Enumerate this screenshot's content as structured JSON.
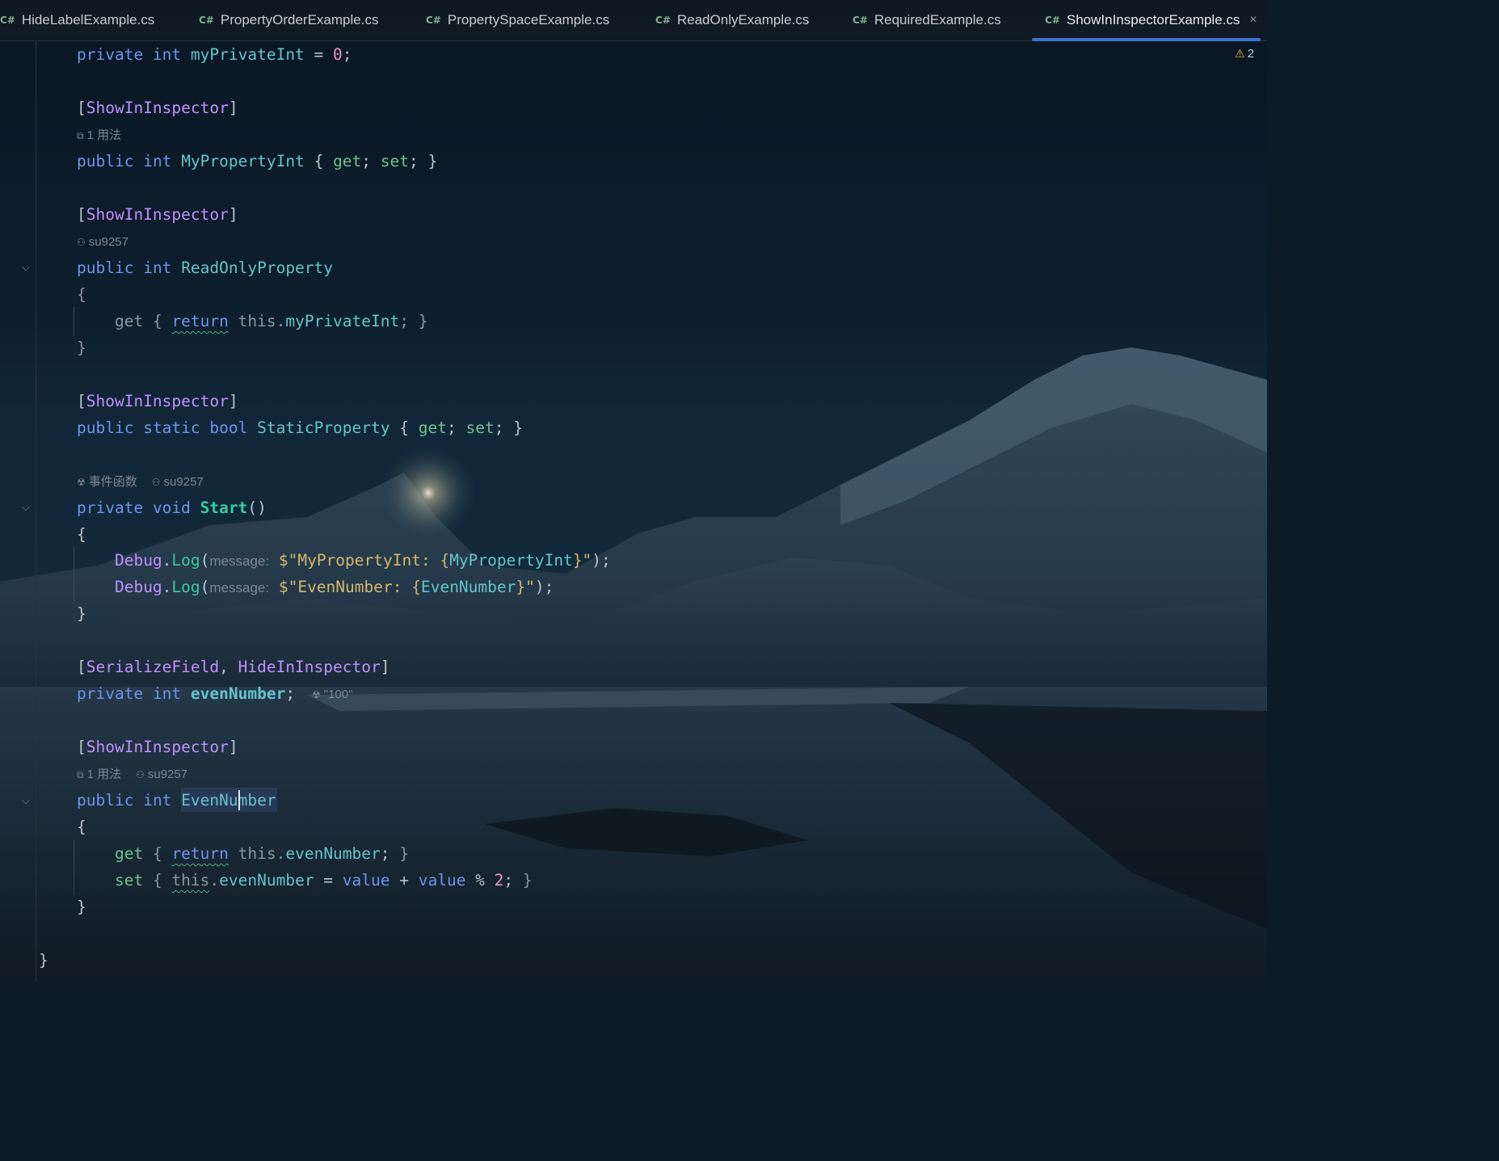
{
  "tabs": [
    {
      "label": "HideLabelExample.cs",
      "icon": "csharp-file-icon"
    },
    {
      "label": "PropertyOrderExample.cs",
      "icon": "csharp-file-icon"
    },
    {
      "label": "PropertySpaceExample.cs",
      "icon": "csharp-file-icon"
    },
    {
      "label": "ReadOnlyExample.cs",
      "icon": "csharp-file-icon"
    },
    {
      "label": "RequiredExample.cs",
      "icon": "csharp-file-icon"
    },
    {
      "label": "ShowInInspectorExample.cs",
      "icon": "csharp-file-icon",
      "active": true
    }
  ],
  "tab_icon_text": "C#",
  "tab_close_glyph": "×",
  "warning": {
    "icon": "warning-triangle-icon",
    "count": "2"
  },
  "colors": {
    "accent": "#3b74d1",
    "keyword": "#6c95eb",
    "attribute": "#c191ff",
    "member": "#66c3cc",
    "method": "#39cc9b",
    "string": "#d4b86a",
    "number": "#ed94c0"
  },
  "code": {
    "l1": {
      "kw": "private",
      "type": "int",
      "name": "myPrivateInt",
      "eq": " = ",
      "val": "0",
      "end": ";"
    },
    "attr1": "ShowInInspector",
    "hint1": {
      "icon": "usage-icon",
      "text": "1 用法"
    },
    "l2": {
      "kw": "public",
      "type": "int",
      "name": "MyPropertyInt",
      "get": "get",
      "set": "set"
    },
    "attr2": "ShowInInspector",
    "hint2": {
      "icon": "author-icon",
      "text": "su9257"
    },
    "l3": {
      "kw": "public",
      "type": "int",
      "name": "ReadOnlyProperty"
    },
    "l3_body": {
      "get": "get",
      "ret": "return",
      "this": "this",
      "field": "myPrivateInt"
    },
    "attr3": "ShowInInspector",
    "l4": {
      "kw": "public",
      "static": "static",
      "type": "bool",
      "name": "StaticProperty",
      "get": "get",
      "set": "set"
    },
    "hint4": {
      "event_icon": "unity-event-icon",
      "event_text": "事件函数",
      "author_icon": "author-icon",
      "author": "su9257"
    },
    "l5": {
      "kw": "private",
      "type": "void",
      "name": "Start",
      "parens": "()"
    },
    "log1": {
      "cls": "Debug",
      "method": "Log",
      "param": "message:",
      "pre": "$\"MyPropertyInt: {",
      "interp": "MyPropertyInt",
      "post": "}\"",
      "end": ");"
    },
    "log2": {
      "cls": "Debug",
      "method": "Log",
      "param": "message:",
      "pre": "$\"EvenNumber: {",
      "interp": "EvenNumber",
      "post": "}\"",
      "end": ");"
    },
    "attr4a": "SerializeField",
    "attr4b": "HideInInspector",
    "l6": {
      "kw": "private",
      "type": "int",
      "name": "evenNumber",
      "end": ";"
    },
    "hint6": {
      "icon": "unity-serialized-icon",
      "text": "\"100\""
    },
    "attr5": "ShowInInspector",
    "hint5": {
      "usage_icon": "usage-icon",
      "usage": "1 用法",
      "author_icon": "author-icon",
      "author": "su9257"
    },
    "l7": {
      "kw": "public",
      "type": "int",
      "name": "EvenNumber"
    },
    "l7_get": {
      "get": "get",
      "ret": "return",
      "this": "this",
      "field": "evenNumber"
    },
    "l7_set": {
      "set": "set",
      "this": "this",
      "field": "evenNumber",
      "op": " = ",
      "v1": "value",
      "plus": " + ",
      "v2": "value",
      "mod": " % ",
      "num": "2"
    }
  }
}
